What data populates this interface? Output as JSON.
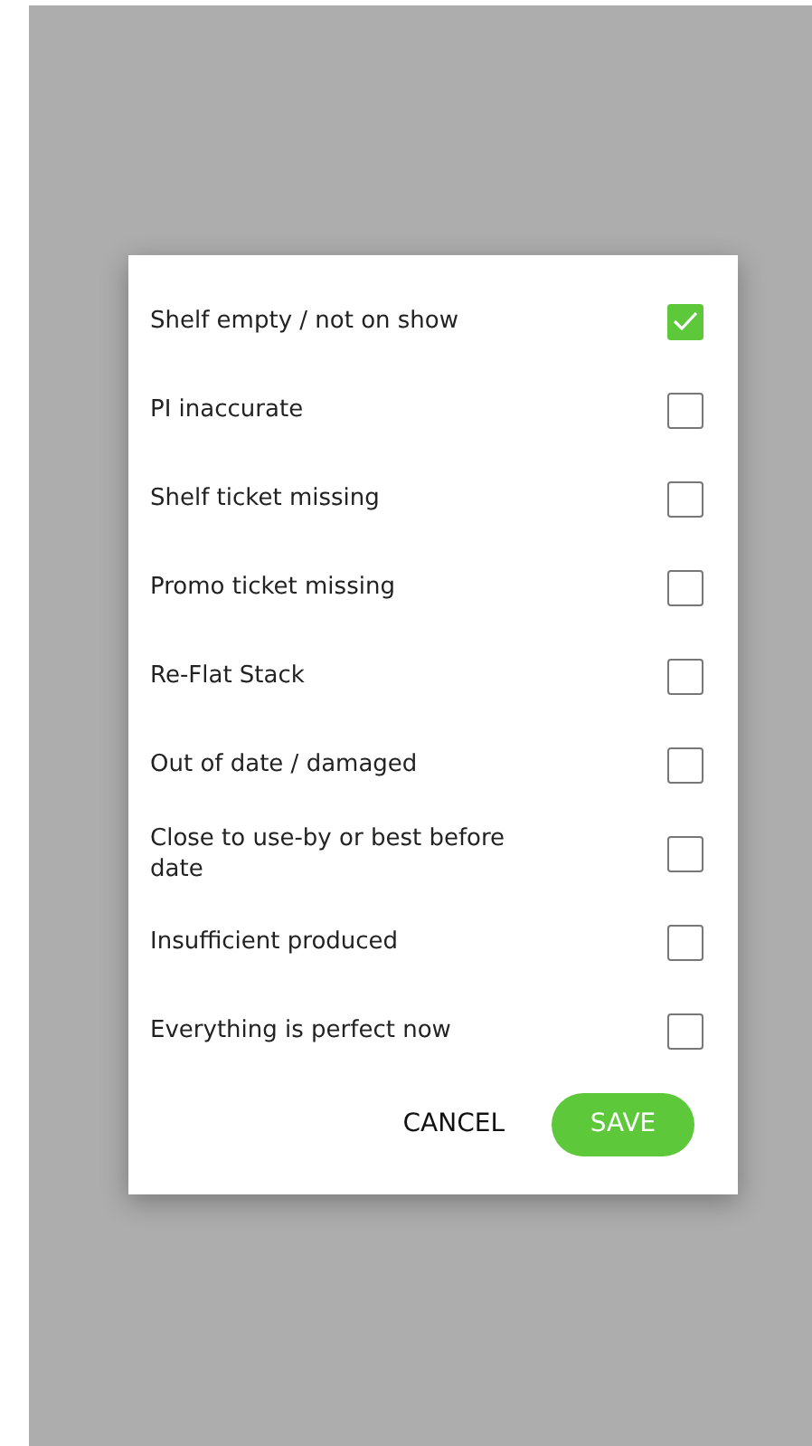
{
  "dialog": {
    "options": [
      {
        "label": "Shelf empty / not on show",
        "checked": true
      },
      {
        "label": "PI inaccurate",
        "checked": false
      },
      {
        "label": "Shelf ticket missing",
        "checked": false
      },
      {
        "label": "Promo ticket missing",
        "checked": false
      },
      {
        "label": "Re-Flat Stack",
        "checked": false
      },
      {
        "label": "Out of date / damaged",
        "checked": false
      },
      {
        "label": "Close to use-by or best before date",
        "checked": false
      },
      {
        "label": "Insufficient produced",
        "checked": false
      },
      {
        "label": "Everything is perfect now",
        "checked": false
      }
    ],
    "buttons": [
      {
        "label": "CANCEL",
        "kind": "text"
      },
      {
        "label": "SAVE",
        "kind": "primary"
      }
    ]
  }
}
